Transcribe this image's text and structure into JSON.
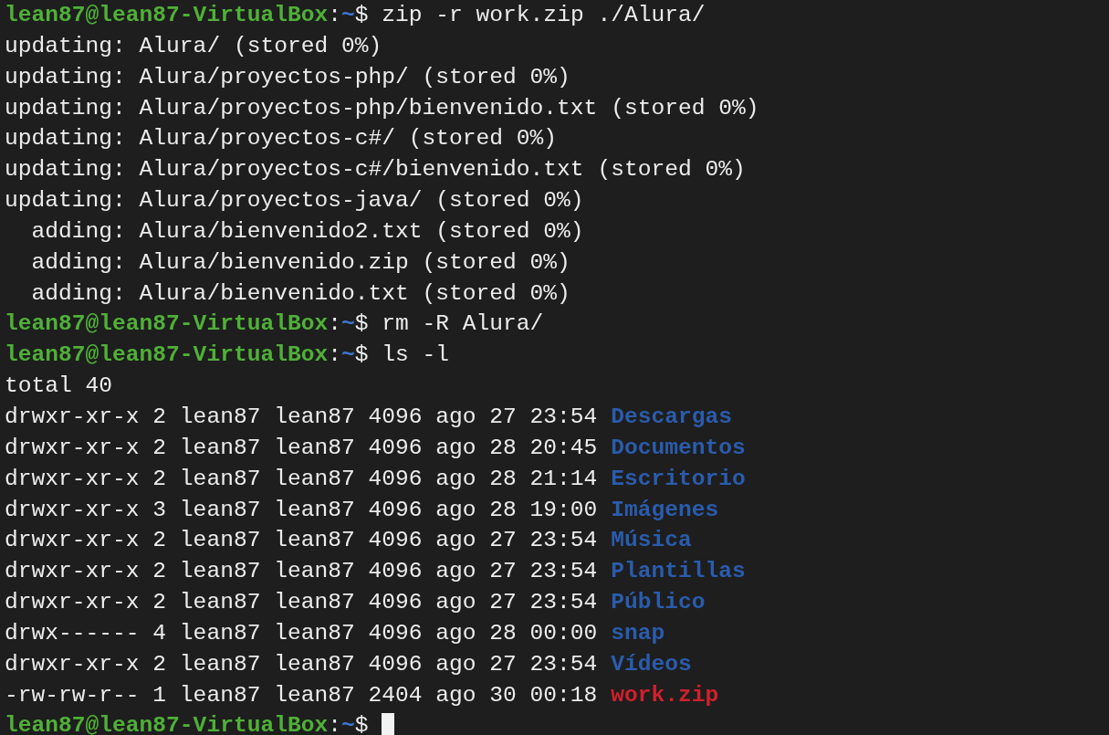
{
  "terminal": {
    "lines": [
      {
        "kind": "prompt",
        "user_host": "lean87@lean87-VirtualBox",
        "separator": ":",
        "path": "~",
        "symbol": "$",
        "command": "zip -r work.zip ./Alura/",
        "cursor": false
      },
      {
        "kind": "output",
        "text": "updating: Alura/ (stored 0%)"
      },
      {
        "kind": "output",
        "text": "updating: Alura/proyectos-php/ (stored 0%)"
      },
      {
        "kind": "output",
        "text": "updating: Alura/proyectos-php/bienvenido.txt (stored 0%)"
      },
      {
        "kind": "output",
        "text": "updating: Alura/proyectos-c#/ (stored 0%)"
      },
      {
        "kind": "output",
        "text": "updating: Alura/proyectos-c#/bienvenido.txt (stored 0%)"
      },
      {
        "kind": "output",
        "text": "updating: Alura/proyectos-java/ (stored 0%)"
      },
      {
        "kind": "output",
        "text": "  adding: Alura/bienvenido2.txt (stored 0%)"
      },
      {
        "kind": "output",
        "text": "  adding: Alura/bienvenido.zip (stored 0%)"
      },
      {
        "kind": "output",
        "text": "  adding: Alura/bienvenido.txt (stored 0%)"
      },
      {
        "kind": "prompt",
        "user_host": "lean87@lean87-VirtualBox",
        "separator": ":",
        "path": "~",
        "symbol": "$",
        "command": "rm -R Alura/",
        "cursor": false
      },
      {
        "kind": "prompt",
        "user_host": "lean87@lean87-VirtualBox",
        "separator": ":",
        "path": "~",
        "symbol": "$",
        "command": "ls -l",
        "cursor": false
      },
      {
        "kind": "output",
        "text": "total 40"
      },
      {
        "kind": "ls_entry",
        "meta": "drwxr-xr-x 2 lean87 lean87 4096 ago 27 23:54",
        "name": "Descargas",
        "color": "#2a5cad"
      },
      {
        "kind": "ls_entry",
        "meta": "drwxr-xr-x 2 lean87 lean87 4096 ago 28 20:45",
        "name": "Documentos",
        "color": "#2a5cad"
      },
      {
        "kind": "ls_entry",
        "meta": "drwxr-xr-x 2 lean87 lean87 4096 ago 28 21:14",
        "name": "Escritorio",
        "color": "#2a5cad"
      },
      {
        "kind": "ls_entry",
        "meta": "drwxr-xr-x 3 lean87 lean87 4096 ago 28 19:00",
        "name": "Imágenes",
        "color": "#2a5cad"
      },
      {
        "kind": "ls_entry",
        "meta": "drwxr-xr-x 2 lean87 lean87 4096 ago 27 23:54",
        "name": "Música",
        "color": "#2a5cad"
      },
      {
        "kind": "ls_entry",
        "meta": "drwxr-xr-x 2 lean87 lean87 4096 ago 27 23:54",
        "name": "Plantillas",
        "color": "#2a5cad"
      },
      {
        "kind": "ls_entry",
        "meta": "drwxr-xr-x 2 lean87 lean87 4096 ago 27 23:54",
        "name": "Público",
        "color": "#2a5cad"
      },
      {
        "kind": "ls_entry",
        "meta": "drwx------ 4 lean87 lean87 4096 ago 28 00:00",
        "name": "snap",
        "color": "#2a5cad"
      },
      {
        "kind": "ls_entry",
        "meta": "drwxr-xr-x 2 lean87 lean87 4096 ago 27 23:54",
        "name": "Vídeos",
        "color": "#2a5cad"
      },
      {
        "kind": "ls_entry",
        "meta": "-rw-rw-r-- 1 lean87 lean87 2404 ago 30 00:18",
        "name": "work.zip",
        "color": "#d0202c"
      },
      {
        "kind": "prompt",
        "user_host": "lean87@lean87-VirtualBox",
        "separator": ":",
        "path": "~",
        "symbol": "$",
        "cursor": true
      }
    ]
  }
}
